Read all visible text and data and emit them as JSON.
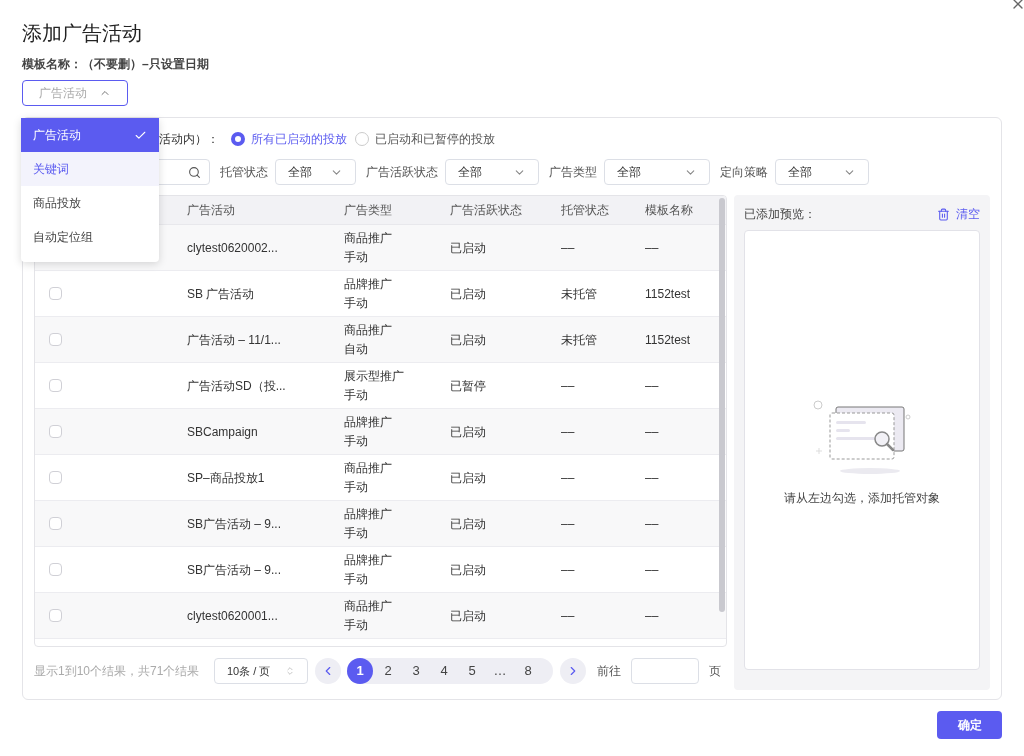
{
  "window": {
    "title": "添加广告活动"
  },
  "template_label": "模板名称：（不要删）–只设置日期",
  "type_select": {
    "placeholder": "广告活动",
    "expanded": true
  },
  "type_options": [
    {
      "label": "广告活动",
      "selected": true,
      "hovered": false
    },
    {
      "label": "关键词",
      "selected": false,
      "hovered": true
    },
    {
      "label": "商品投放",
      "selected": false,
      "hovered": false
    },
    {
      "label": "自动定位组",
      "selected": false,
      "hovered": false
    }
  ],
  "scope": {
    "label": "活动内）：",
    "options": [
      {
        "label": "所有已启动的投放",
        "selected": true
      },
      {
        "label": "已启动和已暂停的投放",
        "selected": false
      }
    ]
  },
  "filters": [
    {
      "label": "托管状态",
      "value": "全部"
    },
    {
      "label": "广告活跃状态",
      "value": "全部"
    },
    {
      "label": "广告类型",
      "value": "全部"
    },
    {
      "label": "定向策略",
      "value": "全部"
    }
  ],
  "table": {
    "columns": [
      "广告活动",
      "广告类型",
      "广告活跃状态",
      "托管状态",
      "模板名称"
    ],
    "rows": [
      {
        "campaign": "clytest0620002...",
        "type": [
          "商品推广",
          "手动"
        ],
        "active": "已启动",
        "managed": "––",
        "template": "––"
      },
      {
        "checked": false,
        "campaign": "SB 广告活动",
        "type": [
          "品牌推广",
          "手动"
        ],
        "active": "已启动",
        "managed": "未托管",
        "template": "1152test"
      },
      {
        "checked": false,
        "campaign": "广告活动 – 11/1...",
        "type": [
          "商品推广",
          "自动"
        ],
        "active": "已启动",
        "managed": "未托管",
        "template": "1152test"
      },
      {
        "checked": false,
        "campaign": "广告活动SD（投...",
        "type": [
          "展示型推广",
          "手动"
        ],
        "active": "已暂停",
        "managed": "––",
        "template": "––"
      },
      {
        "checked": false,
        "campaign": "SBCampaign",
        "type": [
          "品牌推广",
          "手动"
        ],
        "active": "已启动",
        "managed": "––",
        "template": "––"
      },
      {
        "checked": false,
        "campaign": "SP–商品投放1",
        "type": [
          "商品推广",
          "手动"
        ],
        "active": "已启动",
        "managed": "––",
        "template": "––"
      },
      {
        "checked": false,
        "campaign": "SB广告活动 – 9...",
        "type": [
          "品牌推广",
          "手动"
        ],
        "active": "已启动",
        "managed": "––",
        "template": "––"
      },
      {
        "checked": false,
        "campaign": "SB广告活动 – 9...",
        "type": [
          "品牌推广",
          "手动"
        ],
        "active": "已启动",
        "managed": "––",
        "template": "––"
      },
      {
        "checked": false,
        "campaign": "clytest0620001...",
        "type": [
          "商品推广",
          "手动"
        ],
        "active": "已启动",
        "managed": "––",
        "template": "––"
      }
    ]
  },
  "pagination": {
    "summary": "显示1到10个结果，共71个结果",
    "page_size": "10条 / 页",
    "pages": [
      {
        "label": "1",
        "selected": true
      },
      {
        "label": "2",
        "selected": false
      },
      {
        "label": "3",
        "selected": false
      },
      {
        "label": "4",
        "selected": false
      },
      {
        "label": "5",
        "selected": false
      },
      {
        "label": "…",
        "selected": false
      },
      {
        "label": "8",
        "selected": false
      }
    ],
    "goto_label": "前往",
    "page_unit": "页"
  },
  "preview": {
    "title": "已添加预览：",
    "clear": "清空",
    "empty_text": "请从左边勾选，添加托管对象"
  },
  "confirm": "确定"
}
